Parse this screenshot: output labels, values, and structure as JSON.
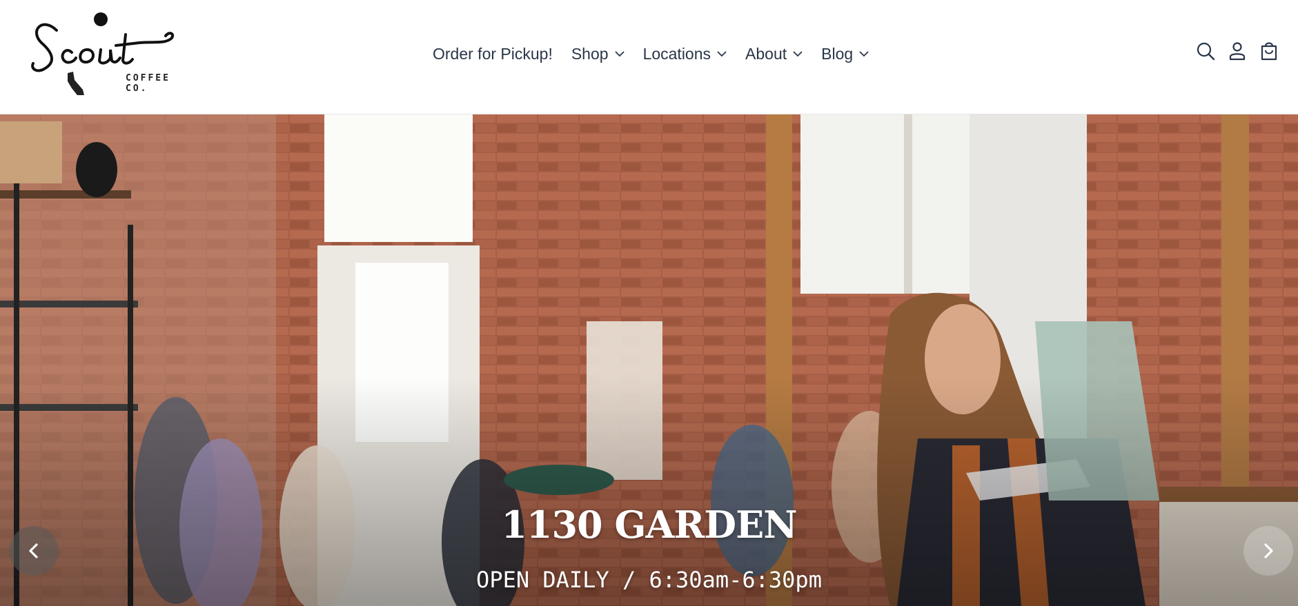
{
  "brand": {
    "script_name": "Scout",
    "badge_letter": "S",
    "subtitle_line1": "COFFEE",
    "subtitle_line2": "CO."
  },
  "nav": {
    "items": [
      {
        "label": "Order for Pickup!",
        "has_dropdown": false
      },
      {
        "label": "Shop",
        "has_dropdown": true
      },
      {
        "label": "Locations",
        "has_dropdown": true
      },
      {
        "label": "About",
        "has_dropdown": true
      },
      {
        "label": "Blog",
        "has_dropdown": true
      }
    ]
  },
  "header_icons": [
    "search-icon",
    "account-icon",
    "cart-icon"
  ],
  "hero": {
    "title": "1130 GARDEN",
    "subtitle": "OPEN DAILY / 6:30am-6:30pm",
    "prev_icon": "chevron-left-icon",
    "next_icon": "chevron-right-icon"
  },
  "colors": {
    "nav_text": "#2a3547",
    "brick": "#a8624a",
    "hero_text": "#ffffff"
  }
}
